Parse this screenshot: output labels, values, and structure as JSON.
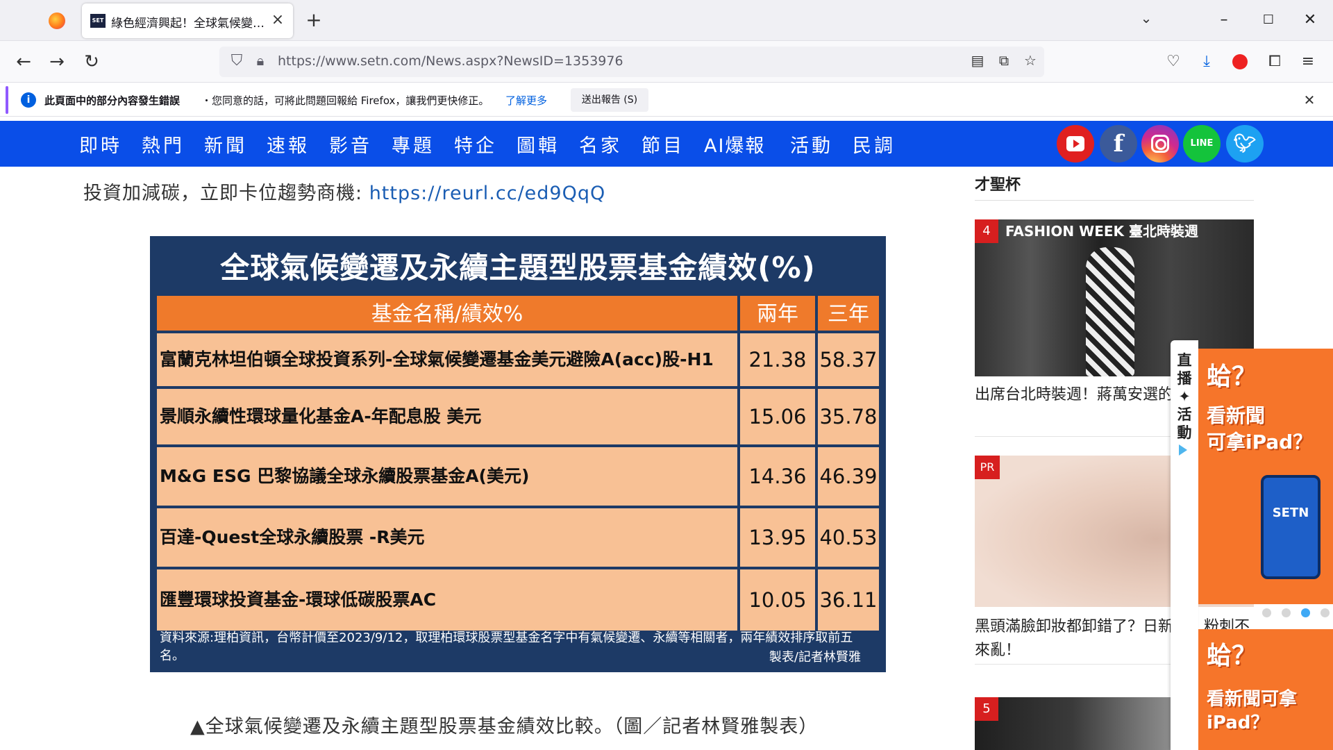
{
  "browser": {
    "tab_title": "綠色經濟興起！全球氣候變遷型",
    "tab_favicon": "SET",
    "url": "https://www.setn.com/News.aspx?NewsID=1353976"
  },
  "infobar": {
    "bold": "此頁面中的部分內容發生錯誤",
    "text": "・您同意的話，可將此問題回報給 Firefox，讓我們更快修正。",
    "link": "了解更多",
    "button": "送出報告 (S)"
  },
  "sitenav": {
    "items": [
      "即時",
      "熱門",
      "新聞",
      "速報",
      "影音",
      "專題",
      "特企",
      "圖輯",
      "名家",
      "節目",
      "AI爆報",
      "活動",
      "民調"
    ],
    "social": {
      "youtube": "youtube-icon",
      "facebook": "f",
      "instagram": "instagram-icon",
      "line": "LINE",
      "twitter": "twitter-icon"
    }
  },
  "article": {
    "lead_text": "投資加減碳，立即卡位趨勢商機: ",
    "lead_link": "https://reurl.cc/ed9QqQ",
    "caption": "▲全球氣候變遷及永續主題型股票基金績效比較。（圖／記者林賢雅製表）"
  },
  "figure": {
    "title": "全球氣候變遷及永續主題型股票基金績效(%)",
    "headers": [
      "基金名稱/績效%",
      "兩年",
      "三年"
    ],
    "rows": [
      {
        "name": "富蘭克林坦伯頓全球投資系列-全球氣候變遷基金美元避險A(acc)股-H1",
        "two": "21.38",
        "three": "58.37"
      },
      {
        "name": "景順永續性環球量化基金A-年配息股 美元",
        "two": "15.06",
        "three": "35.78"
      },
      {
        "name": "M&G ESG 巴黎協議全球永續股票基金A(美元)",
        "two": "14.36",
        "three": "46.39"
      },
      {
        "name": "百達-Quest全球永續股票 -R美元",
        "two": "13.95",
        "three": "40.53"
      },
      {
        "name": "匯豐環球投資基金-環球低碳股票AC",
        "two": "10.05",
        "three": "36.11"
      }
    ],
    "source": "資料來源:理柏資訊，台幣計價至2023/9/12，取理柏環球股票型基金名字中有氣候變遷、永續等相關者，兩年績效排序取前五名。",
    "credit": "製表/記者林賢雅"
  },
  "sidebar": {
    "top_title": "才聖杯",
    "cards": [
      {
        "badge": "4",
        "title": "出席台北時裝週！蔣萬安選的",
        "img_text": "FASHION WEEK 臺北時裝週"
      },
      {
        "badge": "PR",
        "title": "黑頭滿臉卸妝都卸錯了？日新招，粉刺不來亂！"
      },
      {
        "badge": "5"
      }
    ]
  },
  "live_panel": {
    "label": "直播✦活動",
    "promo1": {
      "line1": "蛤？",
      "line2": "看新聞",
      "line3": "可拿iPad？",
      "logo": "SETN"
    },
    "promo2": {
      "line1": "蛤？",
      "line2": "看新聞可拿",
      "line3": "iPad？"
    }
  }
}
